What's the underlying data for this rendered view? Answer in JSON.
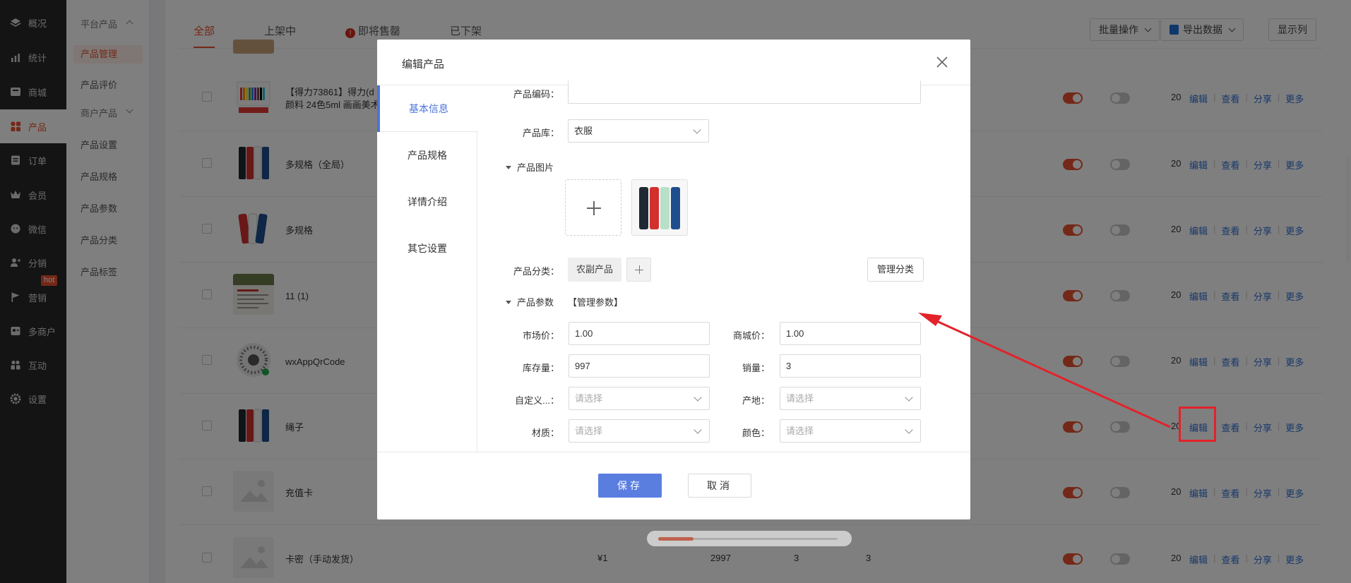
{
  "sidebar": {
    "items": [
      {
        "label": "概况",
        "icon": "layers-icon"
      },
      {
        "label": "统计",
        "icon": "chart-icon"
      },
      {
        "label": "商城",
        "icon": "shop-icon"
      },
      {
        "label": "产品",
        "icon": "grid-icon"
      },
      {
        "label": "订单",
        "icon": "order-icon"
      },
      {
        "label": "会员",
        "icon": "crown-icon"
      },
      {
        "label": "微信",
        "icon": "wechat-icon"
      },
      {
        "label": "分销",
        "icon": "user-share-icon"
      },
      {
        "label": "营销",
        "icon": "flag-icon"
      },
      {
        "label": "多商户",
        "icon": "merchant-icon"
      },
      {
        "label": "互动",
        "icon": "interact-icon"
      },
      {
        "label": "设置",
        "icon": "gear-icon"
      }
    ],
    "hot_badge": "hot"
  },
  "subnav": {
    "group1": "平台产品",
    "items1": [
      "产品管理",
      "产品评价"
    ],
    "group2": "商户产品",
    "items2": [
      "产品设置",
      "产品规格",
      "产品参数",
      "产品分类",
      "产品标签"
    ]
  },
  "list": {
    "tabs": [
      "全部",
      "上架中",
      "即将售罄",
      "已下架"
    ],
    "buttons": {
      "batch": "批量操作",
      "export": "导出数据",
      "columns": "显示列"
    },
    "rows": [
      {
        "name": "【得力73861】得力(d\n颜料 24色5ml 画画美术"
      },
      {
        "name": "多规格（全局）"
      },
      {
        "name": "多规格"
      },
      {
        "name": "11 (1)"
      },
      {
        "name": "wxAppQrCode"
      },
      {
        "name": "绳子"
      },
      {
        "name": "充值卡"
      },
      {
        "name": "卡密（手动发货）",
        "price": "¥1",
        "stock": "2997",
        "c1": "3",
        "c2": "3"
      }
    ],
    "num_prefix": "20",
    "actions": [
      "编辑",
      "查看",
      "分享",
      "更多"
    ]
  },
  "dialog": {
    "title": "编辑产品",
    "tabs": [
      "基本信息",
      "产品规格",
      "详情介绍",
      "其它设置"
    ],
    "code_label": "产品编码：",
    "code_value": "",
    "lib_label": "产品库：",
    "lib_value": "衣服",
    "images_section": "产品图片",
    "category_label": "产品分类：",
    "category_chip": "农副产品",
    "manage_category": "管理分类",
    "params_section": "产品参数",
    "manage_params": "【管理参数】",
    "fields": {
      "market_price_label": "市场价：",
      "market_price": "1.00",
      "mall_price_label": "商城价：",
      "mall_price": "1.00",
      "stock_label": "库存量：",
      "stock": "997",
      "sales_label": "销量：",
      "sales": "3",
      "custom_label": "自定义...：",
      "custom_ph": "请选择",
      "origin_label": "产地：",
      "origin_ph": "请选择",
      "material_label": "材质：",
      "material_ph": "请选择",
      "color_label": "颜色：",
      "color_ph": "请选择"
    },
    "save": "保存",
    "cancel": "取消"
  },
  "colors": {
    "accent": "#e9502e",
    "primary": "#5a7ee0",
    "link": "#2f6fd6",
    "annotation": "#e3222a"
  }
}
